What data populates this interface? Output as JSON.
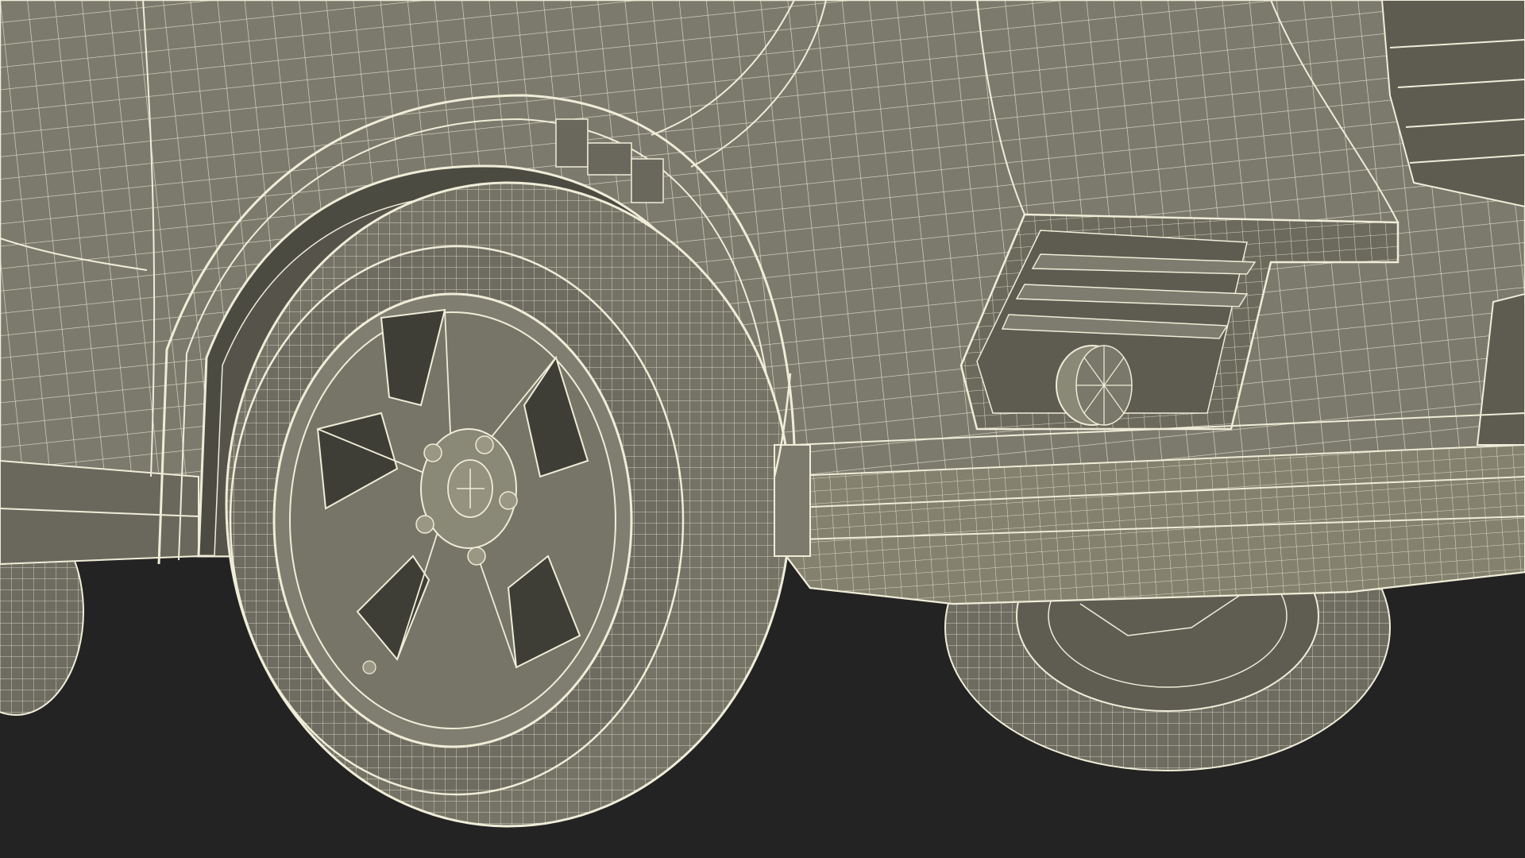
{
  "scene": {
    "subject": "wireframe-car-front-wheel",
    "colors": {
      "background": "#232323",
      "body_fill": "#7c7a6d",
      "body_shadow": "#5f5d52",
      "arch_dark": "#4a4940",
      "tire_fill": "#757366",
      "tire_side": "#6b695d",
      "rim_fill": "#807e70",
      "wire": "#f2f0dc",
      "wire_dim": "#cfcdb8"
    },
    "wheel": {
      "spoke_count": 5,
      "lug_nut_count": 5
    }
  }
}
